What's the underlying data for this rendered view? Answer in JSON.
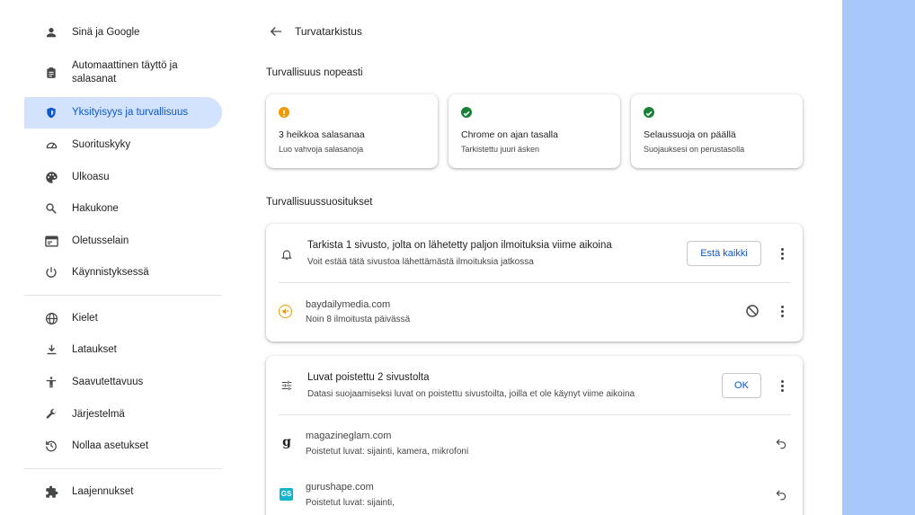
{
  "sidebar": {
    "items": [
      {
        "label": "Sinä ja Google",
        "icon": "person-icon"
      },
      {
        "label": "Automaattinen täyttö ja salasanat",
        "icon": "clipboard-icon"
      },
      {
        "label": "Yksityisyys ja turvallisuus",
        "icon": "shield-icon"
      },
      {
        "label": "Suorituskyky",
        "icon": "speedometer-icon"
      },
      {
        "label": "Ulkoasu",
        "icon": "palette-icon"
      },
      {
        "label": "Hakukone",
        "icon": "search-icon"
      },
      {
        "label": "Oletusselain",
        "icon": "browser-icon"
      },
      {
        "label": "Käynnistyksessä",
        "icon": "power-icon"
      },
      {
        "label": "Kielet",
        "icon": "globe-icon"
      },
      {
        "label": "Lataukset",
        "icon": "download-icon"
      },
      {
        "label": "Saavutettavuus",
        "icon": "accessibility-icon"
      },
      {
        "label": "Järjestelmä",
        "icon": "wrench-icon"
      },
      {
        "label": "Nollaa asetukset",
        "icon": "reset-icon"
      },
      {
        "label": "Laajennukset",
        "icon": "puzzle-icon"
      }
    ],
    "active_index": 2
  },
  "header": {
    "title": "Turvatarkistus"
  },
  "quick": {
    "title": "Turvallisuus nopeasti",
    "cards": [
      {
        "title": "3 heikkoa salasanaa",
        "sub": "Luo vahvoja salasanoja",
        "status": "warning",
        "color": "#f29900"
      },
      {
        "title": "Chrome on ajan tasalla",
        "sub": "Tarkistettu juuri äsken",
        "status": "ok",
        "color": "#188038"
      },
      {
        "title": "Selaussuoja on päällä",
        "sub": "Suojauksesi on perustasolla",
        "status": "ok",
        "color": "#188038"
      }
    ]
  },
  "recommendations": {
    "title": "Turvallisuussuositukset",
    "notifications": {
      "title": "Tarkista 1 sivusto, jolta on lähetetty paljon ilmoituksia viime aikoina",
      "sub": "Voit estää tätä sivustoa lähettämästä ilmoituksia jatkossa",
      "button": "Estä kaikki",
      "site": {
        "name": "baydailymedia.com",
        "sub": "Noin 8 ilmoitusta päivässä"
      }
    },
    "permissions": {
      "title": "Luvat poistettu 2 sivustolta",
      "sub": "Datasi suojaamiseksi luvat on poistettu sivustoilta, joilla et ole käynyt viime aikoina",
      "button": "OK",
      "sites": [
        {
          "name": "magazineglam.com",
          "sub": "Poistetut luvat: sijainti, kamera, mikrofoni",
          "favicon": "g"
        },
        {
          "name": "gurushape.com",
          "sub": "Poistetut luvat: sijainti,",
          "favicon": "GS"
        }
      ]
    }
  },
  "colors": {
    "accent": "#0b57d0",
    "active_bg": "#d3e3fd",
    "right_strip": "#a8c7fa"
  }
}
